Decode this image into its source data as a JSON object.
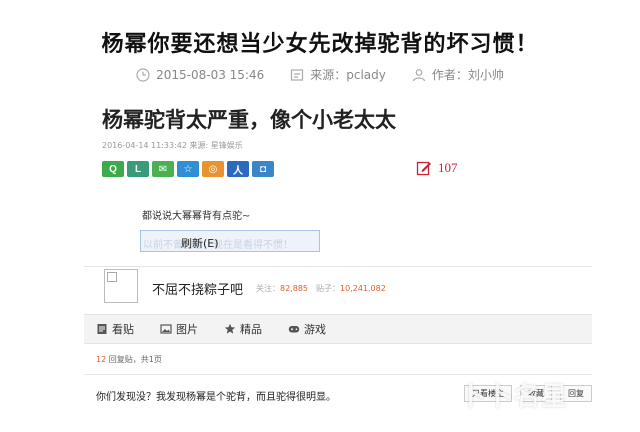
{
  "article": {
    "title": "杨幂你要还想当少女先改掉驼背的坏习惯！",
    "date": "2015-08-03 15:46",
    "source": "来源：pclady",
    "author": "作者：刘小帅"
  },
  "screenshot": {
    "title": "杨幂驼背太严重，像个小老太太",
    "date_line": "2016-04-14 11:33:42  来源: 星锋娱乐",
    "share_buttons": [
      {
        "icon": "qq-icon",
        "glyph": "Q",
        "color": "#3dab4a"
      },
      {
        "icon": "l-icon",
        "glyph": "L",
        "color": "#3a9b78"
      },
      {
        "icon": "wechat-icon",
        "glyph": "✉",
        "color": "#4caf50"
      },
      {
        "icon": "qzone-icon",
        "glyph": "☆",
        "color": "#2f8fd6"
      },
      {
        "icon": "weibo-icon",
        "glyph": "◎",
        "color": "#e89530"
      },
      {
        "icon": "renren-icon",
        "glyph": "人",
        "color": "#2b6bbf"
      },
      {
        "icon": "share-icon",
        "glyph": "◘",
        "color": "#3a86c6"
      }
    ],
    "comment_count": "107",
    "post_text": "都说说大幂幂背有点驼~",
    "context_menu": {
      "ghost_text": "以前不曾注意，现在是看得不惯！",
      "refresh_label": "刷新(E)"
    },
    "profile": {
      "name": "不屈不挠粽子吧",
      "follow_label": "关注：",
      "follow_count": "82,885",
      "posts_label": "贴子：",
      "posts_count": "10,241,082"
    },
    "tabs": [
      {
        "label": "看贴",
        "icon": "document-icon"
      },
      {
        "label": "图片",
        "icon": "image-icon"
      },
      {
        "label": "精品",
        "icon": "star-icon"
      },
      {
        "label": "游戏",
        "icon": "gamepad-icon"
      }
    ],
    "reply_info": {
      "count": "12",
      "label": "回复贴，共1页"
    },
    "reply": {
      "text": "你们发现没？我发现杨幂是个驼背，而且驼得很明显。",
      "actions": [
        "只看楼主",
        "收藏",
        "回复"
      ]
    }
  },
  "watermark": "卜卜名星",
  "colors": {
    "accent_red": "#c23",
    "number_orange": "#e0602a"
  }
}
